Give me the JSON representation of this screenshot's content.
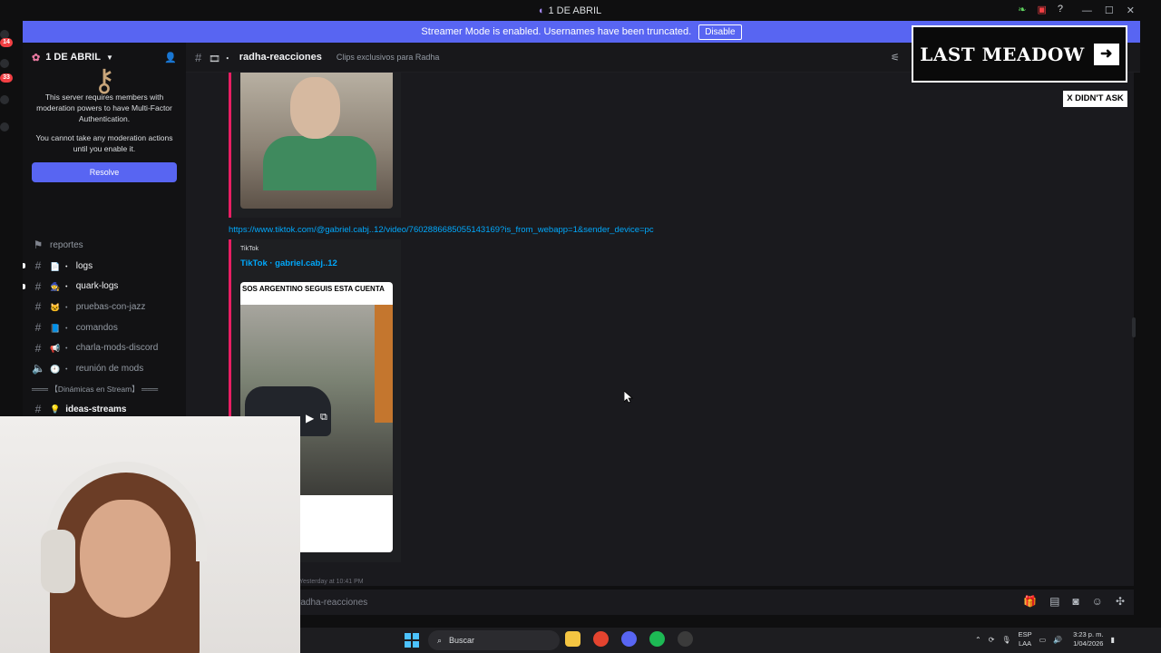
{
  "window": {
    "title": "1 DE ABRIL"
  },
  "banner": {
    "text": "Streamer Mode is enabled. Usernames have been truncated.",
    "button": "Disable"
  },
  "guild_badges": [
    "14",
    "33"
  ],
  "server": {
    "name": "1 DE ABRIL"
  },
  "mfa_notice": {
    "line1": "This server requires members with moderation powers to have Multi-Factor Authentication.",
    "line2": "You cannot take any moderation actions until you enable it.",
    "button": "Resolve"
  },
  "channels": [
    {
      "name": "reportes",
      "icon": "forum-icon",
      "prefix": ""
    },
    {
      "name": "logs",
      "icon": "hash-icon",
      "prefix": "📄 ・",
      "unread": true
    },
    {
      "name": "quark-logs",
      "icon": "hash-icon",
      "prefix": "🧙 ・",
      "unread": true
    },
    {
      "name": "pruebas-con-jazz",
      "icon": "hash-icon",
      "prefix": "🐱 ・"
    },
    {
      "name": "comandos",
      "icon": "hash-icon",
      "prefix": "📘 ・"
    },
    {
      "name": "charla-mods-discord",
      "icon": "hash-icon",
      "prefix": "📢 ・"
    },
    {
      "name": "reunión de mods",
      "icon": "speaker-icon",
      "prefix": "🕘 ・"
    }
  ],
  "category": "═══ 【Dinámicas en Stream】 ═══",
  "partial_channel": "ideas-streams",
  "topbar": {
    "channel": "radha-reacciones",
    "topic": "Clips exclusivos para Radha"
  },
  "messages": {
    "link": "https://www.tiktok.com/@gabriel.cabj..12/video/7602886685055143169?is_from_webapp=1&sender_device=pc",
    "embed_provider": "TikTok",
    "embed_author": "TikTok · gabriel.cabj..12",
    "video_caption": "SOS ARGENTINO SEGUIS ESTA CUENTA",
    "next_timestamp": "Yesterday at 10:41 PM"
  },
  "composer": {
    "placeholder": "radha-reacciones"
  },
  "overlay": {
    "logo_text": "LAST MEADOW",
    "badge": "X DIDN'T ASK"
  },
  "taskbar": {
    "search_placeholder": "Buscar",
    "lang_top": "ESP",
    "lang_bottom": "LAA",
    "time": "3:23 p. m.",
    "date": "1/04/2026"
  },
  "colors": {
    "accent": "#5865f2",
    "link": "#00a8fc",
    "embed_border": "#e91e63"
  }
}
